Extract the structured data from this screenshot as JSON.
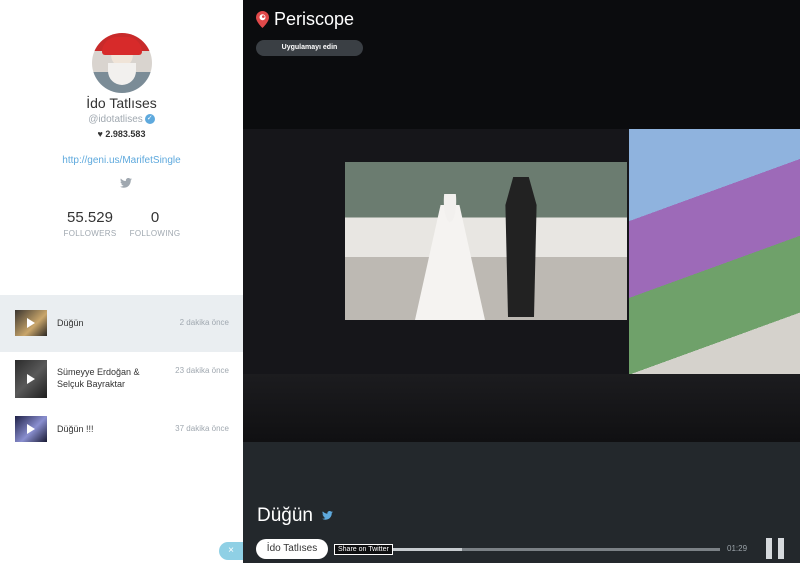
{
  "profile": {
    "name": "İdo Tatlıses",
    "handle": "@idotatlises",
    "hearts": "2.983.583",
    "link": "http://geni.us/MarifetSingle",
    "followers_count": "55.529",
    "followers_label": "FOLLOWERS",
    "following_count": "0",
    "following_label": "FOLLOWING"
  },
  "broadcasts": [
    {
      "title": "Düğün",
      "time": "2 dakika önce"
    },
    {
      "title": "Sümeyye Erdoğan & Selçuk Bayraktar",
      "time": "23 dakika önce"
    },
    {
      "title": "Düğün !!!",
      "time": "37 dakika önce"
    }
  ],
  "player": {
    "logo_text": "Periscope",
    "get_app_label": "Uygulamayı edin",
    "title": "Düğün",
    "user_pill": "İdo Tatlıses",
    "share_tooltip": "Share on Twitter",
    "elapsed": "01:29",
    "progress": 0.21
  },
  "close_label": "×",
  "colors": {
    "accent": "#5ea9dd",
    "periscope_red": "#e0494a",
    "active_row": "#eaeef1"
  }
}
